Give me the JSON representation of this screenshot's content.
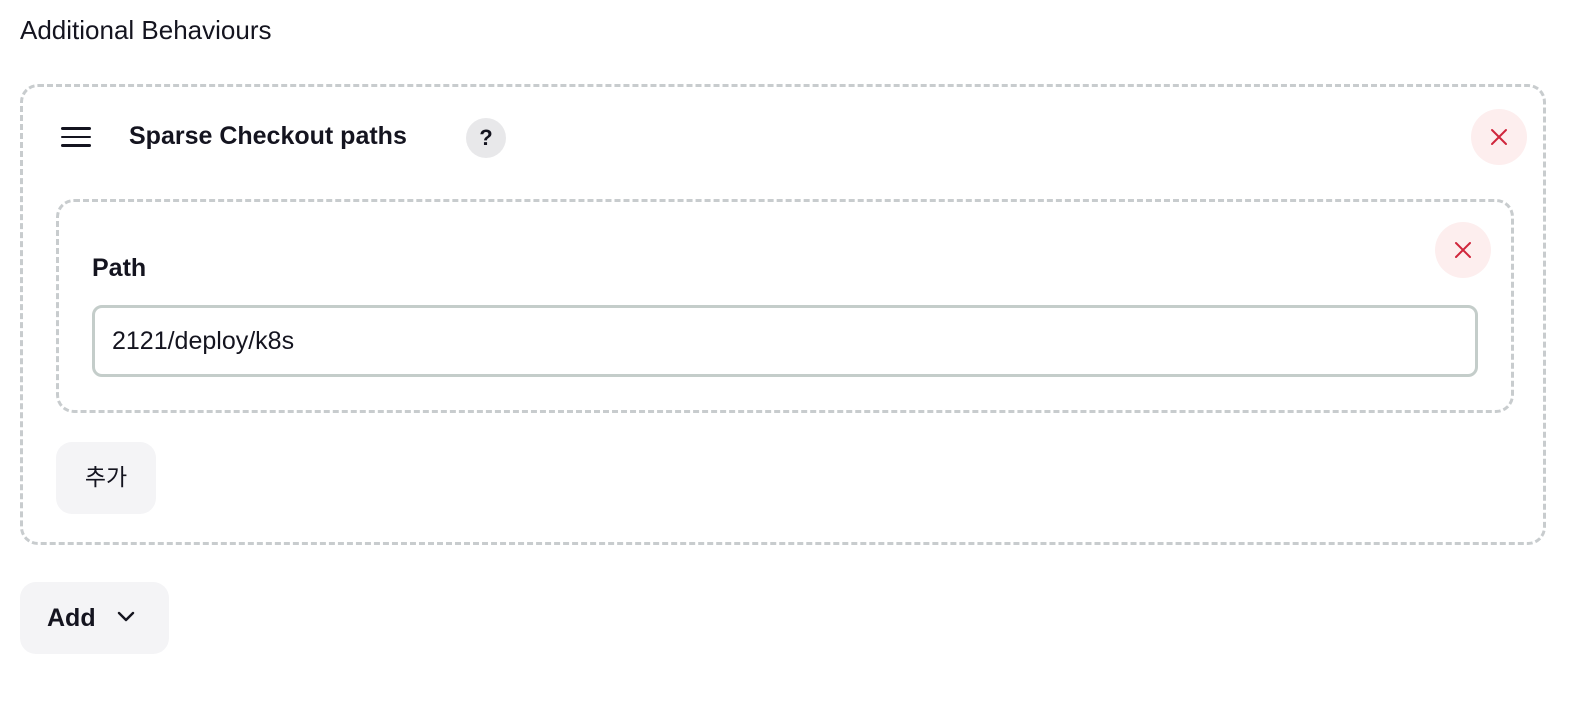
{
  "section": {
    "title": "Additional Behaviours"
  },
  "behaviour_card": {
    "title": "Sparse Checkout paths",
    "help_label": "?",
    "drag_icon": "hamburger-menu-icon",
    "remove_icon": "close-icon",
    "path_entry": {
      "label": "Path",
      "value": "2121/deploy/k8s",
      "remove_icon": "close-icon"
    },
    "add_path_label": "추가"
  },
  "add_menu": {
    "label": "Add",
    "icon": "chevron-down-icon"
  },
  "colors": {
    "text": "#14141f",
    "danger": "#d0263c",
    "danger_bg": "#fdeeee",
    "button_bg": "#f4f4f6",
    "dashed_border": "#c8ccce"
  }
}
